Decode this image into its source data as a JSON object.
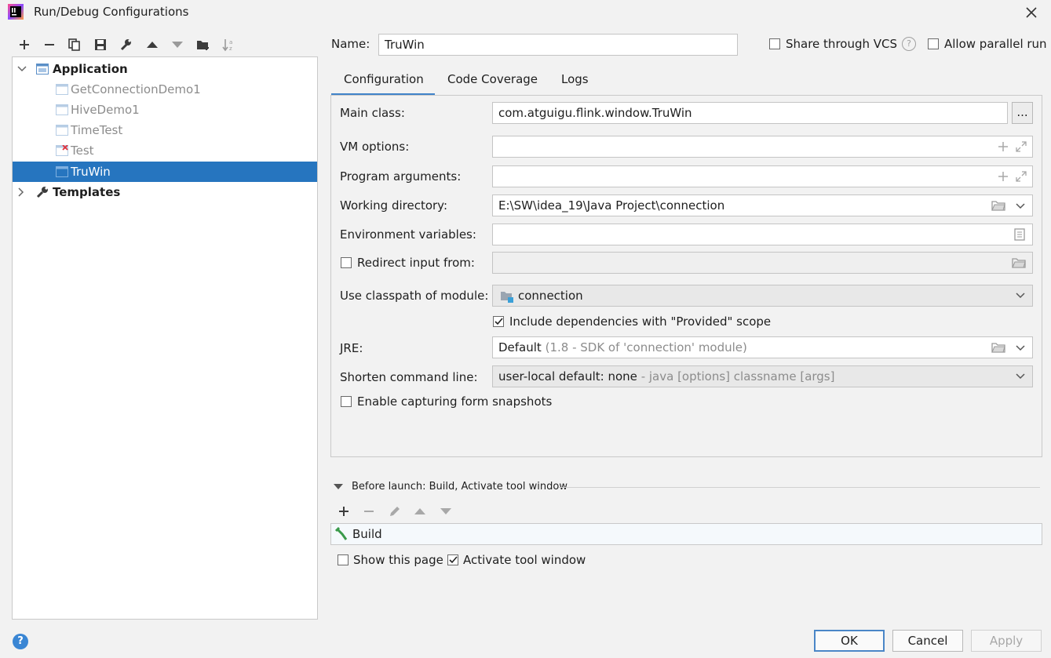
{
  "window": {
    "title": "Run/Debug Configurations"
  },
  "toolbar": {
    "icons": [
      "add-icon",
      "remove-icon",
      "copy-icon",
      "save-icon",
      "wrench-icon",
      "move-up-icon",
      "move-down-icon",
      "new-folder-icon",
      "sort-az-icon"
    ]
  },
  "tree": {
    "application_label": "Application",
    "items": [
      {
        "label": "GetConnectionDemo1"
      },
      {
        "label": "HiveDemo1"
      },
      {
        "label": "TimeTest"
      },
      {
        "label": "Test"
      },
      {
        "label": "TruWin"
      }
    ],
    "templates_label": "Templates"
  },
  "header": {
    "name_label": "Name:",
    "name_value": "TruWin",
    "share_vcs_label": "Share through VCS",
    "allow_parallel_label": "Allow parallel run"
  },
  "tabs": [
    {
      "label": "Configuration"
    },
    {
      "label": "Code Coverage"
    },
    {
      "label": "Logs"
    }
  ],
  "form": {
    "main_class_label": "Main class:",
    "main_class_value": "com.atguigu.flink.window.TruWin",
    "browse_label": "...",
    "vm_options_label": "VM options:",
    "program_args_label": "Program arguments:",
    "working_dir_label": "Working directory:",
    "working_dir_value": "E:\\SW\\idea_19\\Java Project\\connection",
    "env_vars_label": "Environment variables:",
    "redirect_label": "Redirect input from:",
    "classpath_label": "Use classpath of module:",
    "classpath_value": "connection",
    "include_deps_label": "Include dependencies with \"Provided\" scope",
    "jre_label": "JRE:",
    "jre_value": "Default",
    "jre_hint": "(1.8 - SDK of 'connection' module)",
    "shorten_label": "Shorten command line:",
    "shorten_value": "user-local default: none",
    "shorten_hint": "- java [options] classname [args]",
    "snapshots_label": "Enable capturing form snapshots"
  },
  "before_launch": {
    "title": "Before launch: Build, Activate tool window",
    "item_label": "Build",
    "show_page_label": "Show this page",
    "activate_label": "Activate tool window"
  },
  "buttons": {
    "ok": "OK",
    "cancel": "Cancel",
    "apply": "Apply"
  },
  "colors": {
    "accent": "#2675bf",
    "tab_underline": "#4083c9",
    "help": "#3a86d4"
  }
}
